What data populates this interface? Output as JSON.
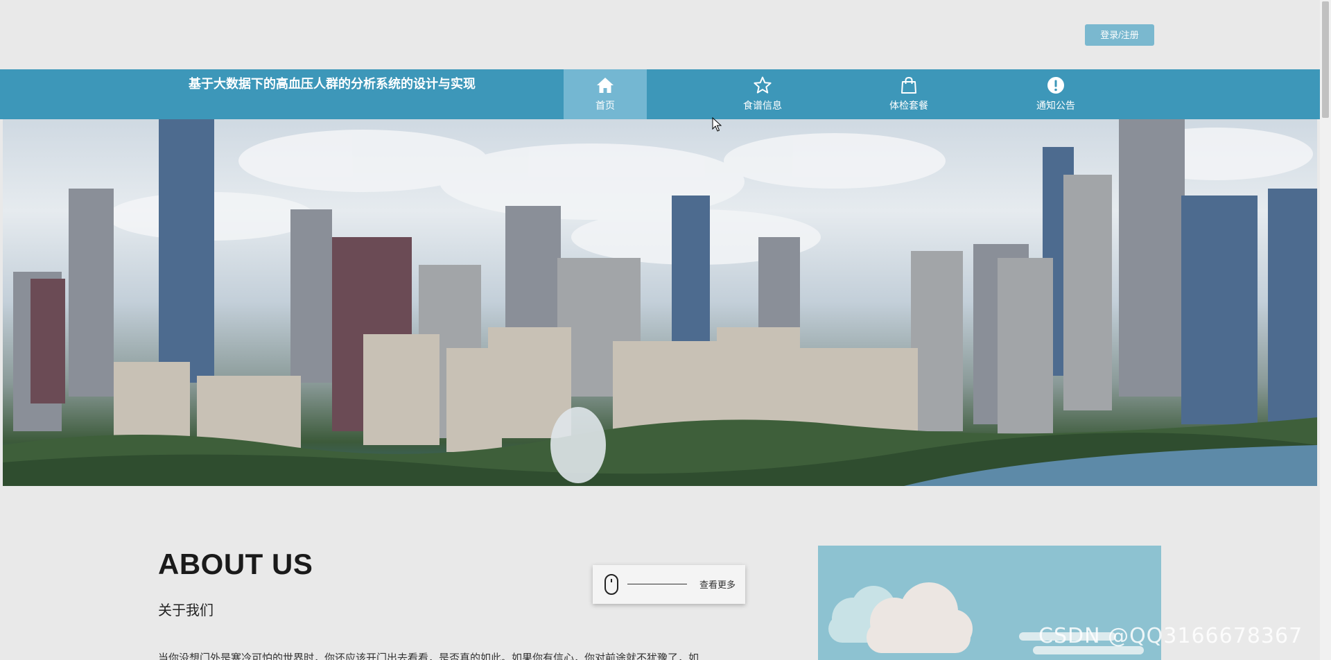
{
  "header": {
    "login_label": "登录/注册"
  },
  "nav": {
    "title": "基于大数据下的高血压人群的分析系统的设计与实现",
    "items": [
      {
        "label": "首页",
        "icon": "home-icon",
        "active": true
      },
      {
        "label": "食谱信息",
        "icon": "star-icon",
        "active": false
      },
      {
        "label": "体检套餐",
        "icon": "shopping-bag-icon",
        "active": false
      },
      {
        "label": "通知公告",
        "icon": "exclamation-circle-icon",
        "active": false
      }
    ]
  },
  "hero": {
    "image": "city-skyline-image"
  },
  "about": {
    "title": "ABOUT US",
    "subtitle": "关于我们",
    "text": "当你没想门外是寒冷可怕的世界时，你还应该开门出去看看，是否真的如此。如果你有信心，你对前途就不犹豫了，如",
    "more_label": "查看更多"
  },
  "watermark": "CSDN @QQ3166678367",
  "colors": {
    "nav_bg": "#3d97b9",
    "nav_active": "#74b7d2",
    "login_bg": "#7ab8cf",
    "page_bg": "#e9e9e9"
  }
}
